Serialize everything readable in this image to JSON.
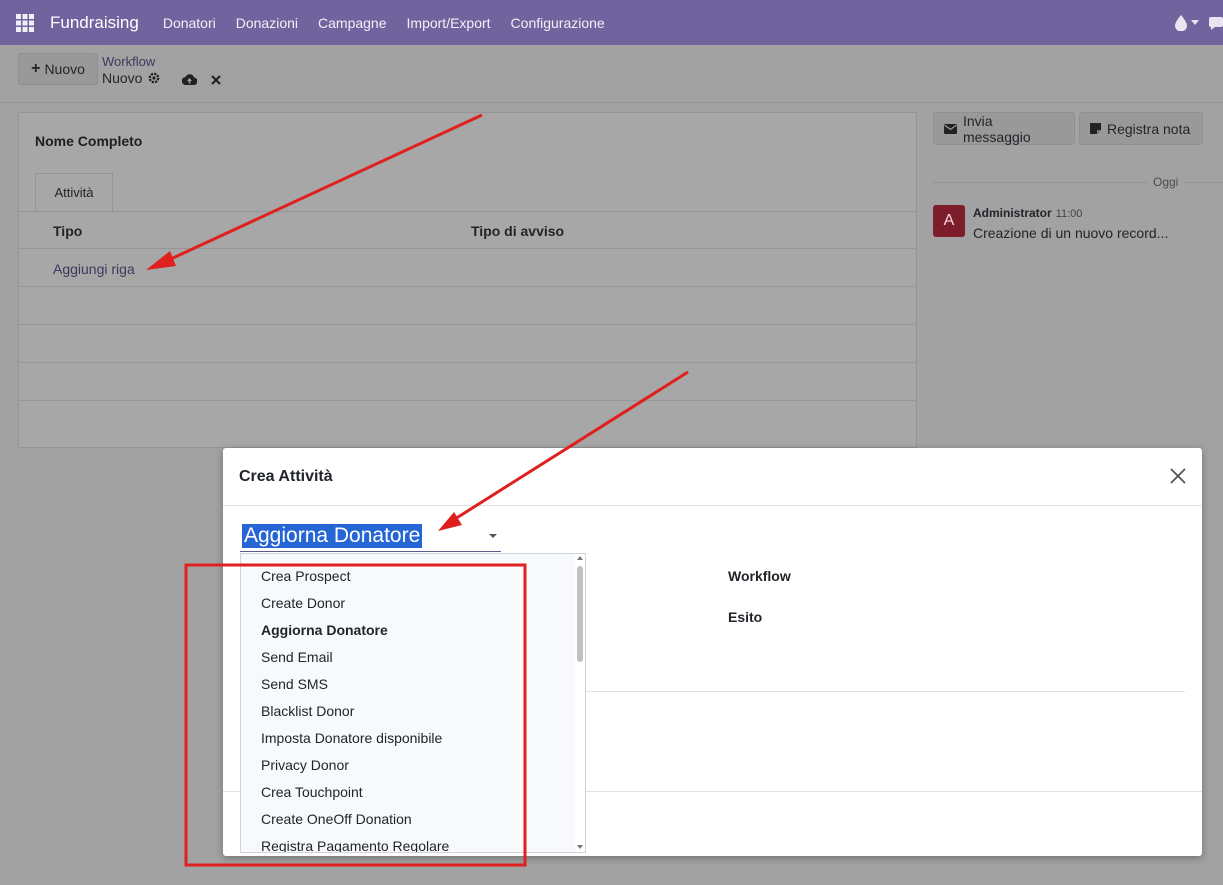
{
  "navbar": {
    "brand": "Fundraising",
    "menu": [
      "Donatori",
      "Donazioni",
      "Campagne",
      "Import/Export",
      "Configurazione"
    ]
  },
  "control": {
    "new_label": "Nuovo",
    "breadcrumb_parent": "Workflow",
    "breadcrumb_current": "Nuovo"
  },
  "form": {
    "name_label": "Nome Completo",
    "tab_label": "Attività",
    "columns": [
      "Tipo",
      "Tipo di avviso"
    ],
    "add_row": "Aggiungi riga"
  },
  "chatter": {
    "send_message": "Invia messaggio",
    "log_note": "Registra nota",
    "today": "Oggi",
    "avatar_letter": "A",
    "author": "Administrator",
    "time": "11:00",
    "message": "Creazione di un nuovo record..."
  },
  "modal": {
    "title": "Crea Attività",
    "selected_value": "Aggiorna Donatore",
    "field_workflow": "Workflow",
    "field_outcome": "Esito"
  },
  "dropdown": {
    "items": [
      "Crea Prospect",
      "Create Donor",
      "Aggiorna Donatore",
      "Send Email",
      "Send SMS",
      "Blacklist Donor",
      "Imposta Donatore disponibile",
      "Privacy Donor",
      "Crea Touchpoint",
      "Create OneOff Donation",
      "Registra Pagamento Regolare"
    ],
    "selected_index": 2
  },
  "colors": {
    "navbar": "#71639e",
    "selection": "#2566d4",
    "annotation": "#e0201e"
  }
}
